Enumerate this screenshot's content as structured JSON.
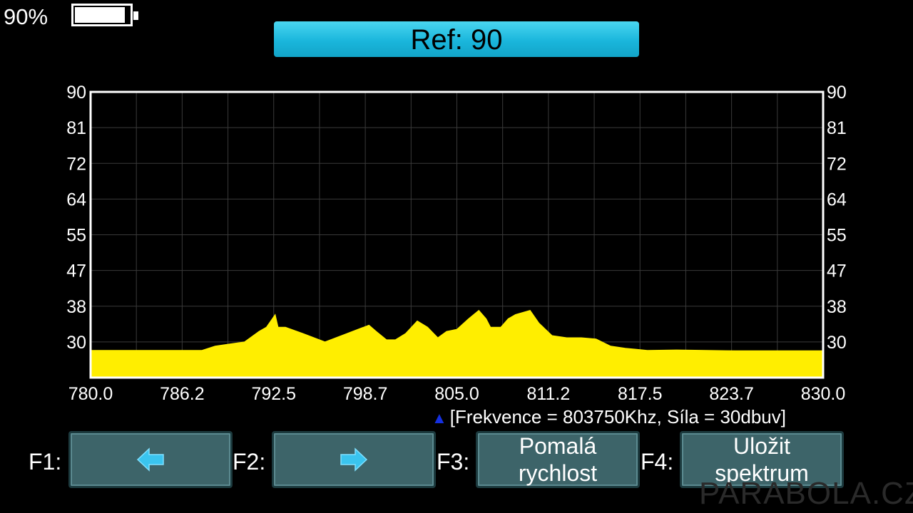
{
  "battery": {
    "percent_label": "90%",
    "level": 0.9
  },
  "header": {
    "ref_label": "Ref: 90"
  },
  "status": {
    "marker_label": "[Frekvence = 803750Khz, Síla = 30dbuv]"
  },
  "fkeys": [
    {
      "key": "F1:",
      "label": "",
      "icon": "arrow-left-icon"
    },
    {
      "key": "F2:",
      "label": "",
      "icon": "arrow-right-icon"
    },
    {
      "key": "F3:",
      "label_line1": "Pomalá",
      "label_line2": "rychlost"
    },
    {
      "key": "F4:",
      "label_line1": "Uložit",
      "label_line2": "spektrum"
    }
  ],
  "watermark": "PARABOLA.CZ",
  "colors": {
    "trace": "#ffee00",
    "accent": "#1ab6dc",
    "button": "#3d6469",
    "marker": "#1530e0"
  },
  "chart_data": {
    "type": "area",
    "x_ticks": [
      "780.0",
      "786.2",
      "792.5",
      "798.7",
      "805.0",
      "811.2",
      "817.5",
      "823.7",
      "830.0"
    ],
    "y_ticks": [
      "90",
      "81",
      "72",
      "64",
      "55",
      "47",
      "38",
      "30"
    ],
    "xlim": [
      780.0,
      830.0
    ],
    "ylim": [
      22,
      90
    ],
    "grid": true,
    "series": [
      {
        "x": [
          780.0,
          785.0,
          787.6,
          788.5,
          789.5,
          790.5,
          791.5,
          792.0,
          792.6,
          792.8,
          793.3,
          794.5,
          796.0,
          797.5,
          799.0,
          799.5,
          800.2,
          800.8,
          801.5,
          802.3,
          803.0,
          803.7,
          804.3,
          805.0,
          805.8,
          806.5,
          807.0,
          807.3,
          808.0,
          808.5,
          809.0,
          810.0,
          810.6,
          811.5,
          812.5,
          813.5,
          814.5,
          815.5,
          816.5,
          818.0,
          820.0,
          824.0,
          830.0
        ],
        "y": [
          28.5,
          28.5,
          28.5,
          29.5,
          30,
          30.5,
          33,
          34,
          37,
          34,
          34,
          32.5,
          30.5,
          32.5,
          34.5,
          33,
          31,
          31,
          32.5,
          35.5,
          34,
          31.5,
          33,
          33.5,
          36,
          38,
          36,
          34,
          34,
          36,
          37,
          38,
          35,
          32,
          31.5,
          31.5,
          31.2,
          29.5,
          29,
          28.5,
          28.6,
          28.4,
          28.4
        ]
      }
    ]
  }
}
